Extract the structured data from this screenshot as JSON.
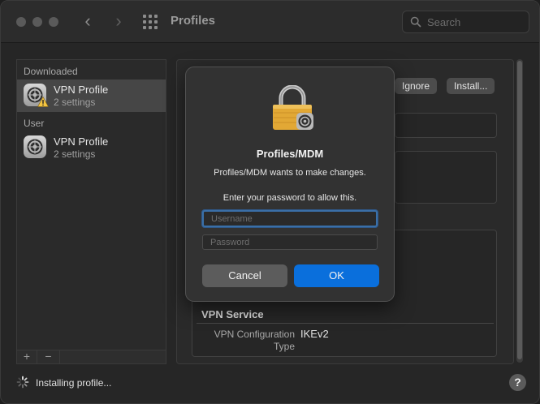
{
  "window": {
    "title": "Profiles"
  },
  "search": {
    "placeholder": "Search"
  },
  "sidebar": {
    "groups": [
      {
        "label": "Downloaded",
        "items": [
          {
            "name": "VPN Profile",
            "subtitle": "2 settings"
          }
        ]
      },
      {
        "label": "User",
        "items": [
          {
            "name": "VPN Profile",
            "subtitle": "2 settings"
          }
        ]
      }
    ],
    "add_label": "+",
    "remove_label": "−"
  },
  "detail": {
    "ignore_label": "Ignore",
    "install_label": "Install...",
    "vpn_section_title": "VPN Service",
    "vpn_rows": [
      {
        "key": "VPN Configuration Type",
        "value": "IKEv2"
      }
    ]
  },
  "footer": {
    "status": "Installing profile...",
    "help_label": "?"
  },
  "dialog": {
    "title": "Profiles/MDM",
    "message": "Profiles/MDM wants to make changes.",
    "prompt": "Enter your password to allow this.",
    "username_placeholder": "Username",
    "password_placeholder": "Password",
    "cancel_label": "Cancel",
    "ok_label": "OK"
  },
  "colors": {
    "accent": "#0a6fdc",
    "focus_ring": "#3a6fa7",
    "lock_gold": "#e2a835",
    "warning": "#f4c542"
  }
}
